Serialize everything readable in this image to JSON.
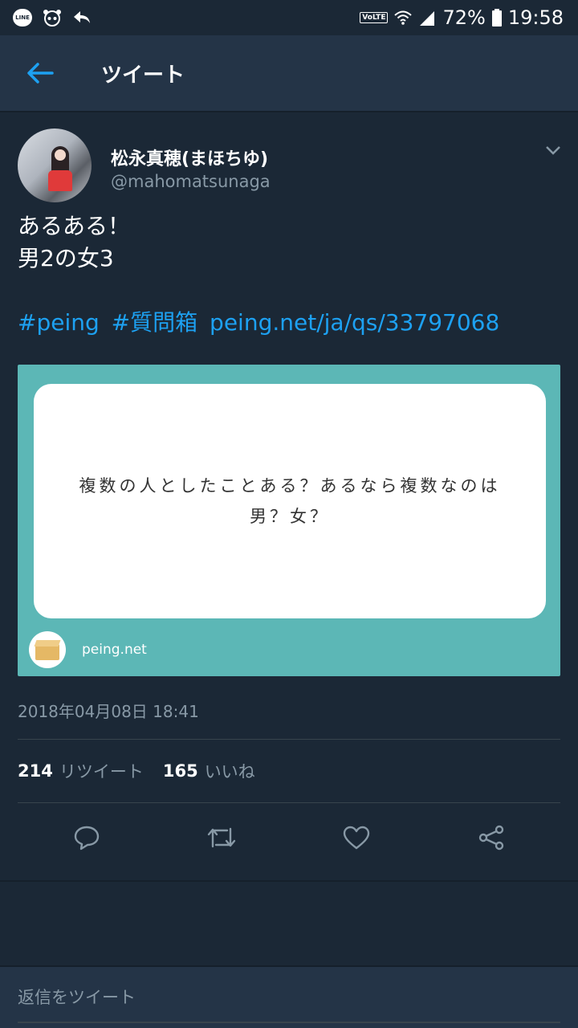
{
  "status_bar": {
    "line_label": "LINE",
    "volte_label": "VoLTE",
    "battery": "72%",
    "time": "19:58"
  },
  "app_bar": {
    "title": "ツイート"
  },
  "tweet": {
    "display_name": "松永真穂(まほちゆ)",
    "handle": "@mahomatsunaga",
    "text_lines": [
      "あるある！",
      "男2の女3"
    ],
    "hashtags": [
      "#peing",
      "#質問箱"
    ],
    "link": "peing.net/ja/qs/33797068",
    "card": {
      "question_lines": [
        "複数の人としたことある？あるなら複数なのは",
        "男？女？"
      ],
      "domain": "peing.net"
    },
    "timestamp": "2018年04月08日 18:41",
    "retweets_count": "214",
    "retweets_label": "リツイート",
    "likes_count": "165",
    "likes_label": "いいね"
  },
  "reply": {
    "placeholder": "返信をツイート"
  },
  "colors": {
    "background": "#1b2836",
    "appbar": "#243447",
    "link": "#1da1f2",
    "muted": "#8899a6",
    "card": "#5cb7b6"
  }
}
